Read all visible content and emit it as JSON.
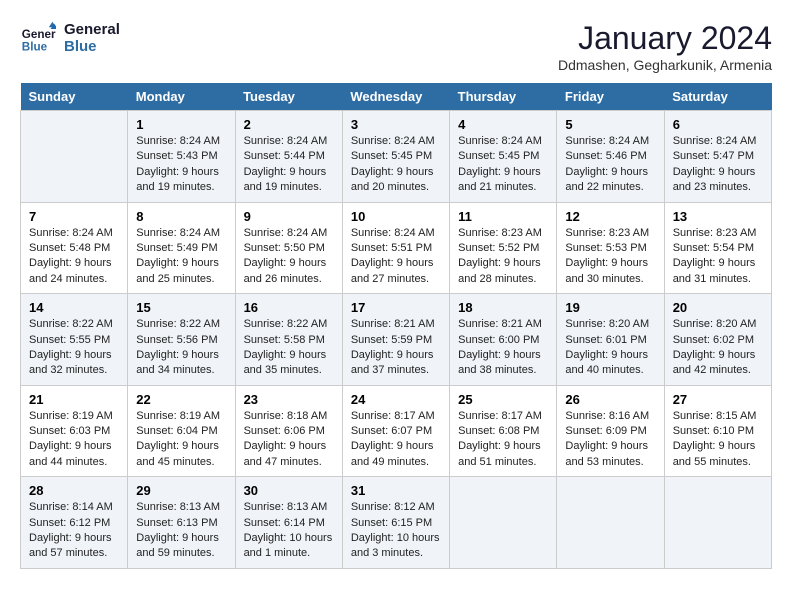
{
  "header": {
    "logo_line1": "General",
    "logo_line2": "Blue",
    "month": "January 2024",
    "location": "Ddmashen, Gegharkunik, Armenia"
  },
  "weekdays": [
    "Sunday",
    "Monday",
    "Tuesday",
    "Wednesday",
    "Thursday",
    "Friday",
    "Saturday"
  ],
  "weeks": [
    [
      {
        "day": "",
        "info": ""
      },
      {
        "day": "1",
        "info": "Sunrise: 8:24 AM\nSunset: 5:43 PM\nDaylight: 9 hours\nand 19 minutes."
      },
      {
        "day": "2",
        "info": "Sunrise: 8:24 AM\nSunset: 5:44 PM\nDaylight: 9 hours\nand 19 minutes."
      },
      {
        "day": "3",
        "info": "Sunrise: 8:24 AM\nSunset: 5:45 PM\nDaylight: 9 hours\nand 20 minutes."
      },
      {
        "day": "4",
        "info": "Sunrise: 8:24 AM\nSunset: 5:45 PM\nDaylight: 9 hours\nand 21 minutes."
      },
      {
        "day": "5",
        "info": "Sunrise: 8:24 AM\nSunset: 5:46 PM\nDaylight: 9 hours\nand 22 minutes."
      },
      {
        "day": "6",
        "info": "Sunrise: 8:24 AM\nSunset: 5:47 PM\nDaylight: 9 hours\nand 23 minutes."
      }
    ],
    [
      {
        "day": "7",
        "info": "Sunrise: 8:24 AM\nSunset: 5:48 PM\nDaylight: 9 hours\nand 24 minutes."
      },
      {
        "day": "8",
        "info": "Sunrise: 8:24 AM\nSunset: 5:49 PM\nDaylight: 9 hours\nand 25 minutes."
      },
      {
        "day": "9",
        "info": "Sunrise: 8:24 AM\nSunset: 5:50 PM\nDaylight: 9 hours\nand 26 minutes."
      },
      {
        "day": "10",
        "info": "Sunrise: 8:24 AM\nSunset: 5:51 PM\nDaylight: 9 hours\nand 27 minutes."
      },
      {
        "day": "11",
        "info": "Sunrise: 8:23 AM\nSunset: 5:52 PM\nDaylight: 9 hours\nand 28 minutes."
      },
      {
        "day": "12",
        "info": "Sunrise: 8:23 AM\nSunset: 5:53 PM\nDaylight: 9 hours\nand 30 minutes."
      },
      {
        "day": "13",
        "info": "Sunrise: 8:23 AM\nSunset: 5:54 PM\nDaylight: 9 hours\nand 31 minutes."
      }
    ],
    [
      {
        "day": "14",
        "info": "Sunrise: 8:22 AM\nSunset: 5:55 PM\nDaylight: 9 hours\nand 32 minutes."
      },
      {
        "day": "15",
        "info": "Sunrise: 8:22 AM\nSunset: 5:56 PM\nDaylight: 9 hours\nand 34 minutes."
      },
      {
        "day": "16",
        "info": "Sunrise: 8:22 AM\nSunset: 5:58 PM\nDaylight: 9 hours\nand 35 minutes."
      },
      {
        "day": "17",
        "info": "Sunrise: 8:21 AM\nSunset: 5:59 PM\nDaylight: 9 hours\nand 37 minutes."
      },
      {
        "day": "18",
        "info": "Sunrise: 8:21 AM\nSunset: 6:00 PM\nDaylight: 9 hours\nand 38 minutes."
      },
      {
        "day": "19",
        "info": "Sunrise: 8:20 AM\nSunset: 6:01 PM\nDaylight: 9 hours\nand 40 minutes."
      },
      {
        "day": "20",
        "info": "Sunrise: 8:20 AM\nSunset: 6:02 PM\nDaylight: 9 hours\nand 42 minutes."
      }
    ],
    [
      {
        "day": "21",
        "info": "Sunrise: 8:19 AM\nSunset: 6:03 PM\nDaylight: 9 hours\nand 44 minutes."
      },
      {
        "day": "22",
        "info": "Sunrise: 8:19 AM\nSunset: 6:04 PM\nDaylight: 9 hours\nand 45 minutes."
      },
      {
        "day": "23",
        "info": "Sunrise: 8:18 AM\nSunset: 6:06 PM\nDaylight: 9 hours\nand 47 minutes."
      },
      {
        "day": "24",
        "info": "Sunrise: 8:17 AM\nSunset: 6:07 PM\nDaylight: 9 hours\nand 49 minutes."
      },
      {
        "day": "25",
        "info": "Sunrise: 8:17 AM\nSunset: 6:08 PM\nDaylight: 9 hours\nand 51 minutes."
      },
      {
        "day": "26",
        "info": "Sunrise: 8:16 AM\nSunset: 6:09 PM\nDaylight: 9 hours\nand 53 minutes."
      },
      {
        "day": "27",
        "info": "Sunrise: 8:15 AM\nSunset: 6:10 PM\nDaylight: 9 hours\nand 55 minutes."
      }
    ],
    [
      {
        "day": "28",
        "info": "Sunrise: 8:14 AM\nSunset: 6:12 PM\nDaylight: 9 hours\nand 57 minutes."
      },
      {
        "day": "29",
        "info": "Sunrise: 8:13 AM\nSunset: 6:13 PM\nDaylight: 9 hours\nand 59 minutes."
      },
      {
        "day": "30",
        "info": "Sunrise: 8:13 AM\nSunset: 6:14 PM\nDaylight: 10 hours\nand 1 minute."
      },
      {
        "day": "31",
        "info": "Sunrise: 8:12 AM\nSunset: 6:15 PM\nDaylight: 10 hours\nand 3 minutes."
      },
      {
        "day": "",
        "info": ""
      },
      {
        "day": "",
        "info": ""
      },
      {
        "day": "",
        "info": ""
      }
    ]
  ]
}
